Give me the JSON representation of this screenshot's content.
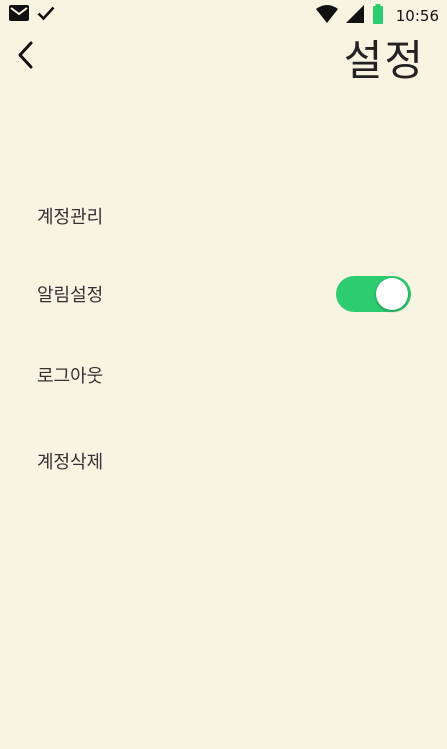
{
  "status_bar": {
    "time": "10:56",
    "icons": [
      "mail-icon",
      "check-icon",
      "wifi-icon",
      "cell-signal-icon",
      "battery-icon"
    ],
    "battery_color": "#2ecc71"
  },
  "header": {
    "title": "설정",
    "back_icon": "chevron-left-icon"
  },
  "menu": {
    "items": [
      {
        "label": "계정관리"
      },
      {
        "label": "알림설정",
        "toggle_on": true
      },
      {
        "label": "로그아웃"
      },
      {
        "label": "계정삭제"
      }
    ]
  },
  "colors": {
    "background": "#f7f4e1",
    "accent": "#2ecc71",
    "text": "#333333"
  }
}
